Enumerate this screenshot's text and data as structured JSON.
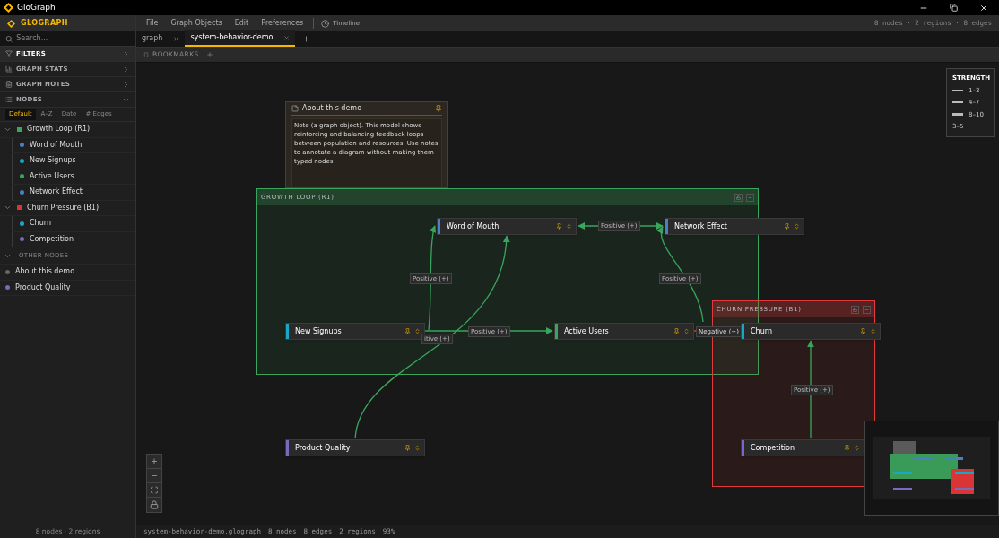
{
  "app": {
    "title": "GloGraph",
    "logo": "GLOGRAPH"
  },
  "search": {
    "placeholder": "Search..."
  },
  "sections": [
    {
      "label": "FILTERS",
      "kind": "filters",
      "expanded": false
    },
    {
      "label": "GRAPH STATS",
      "kind": "stats",
      "expanded": false
    },
    {
      "label": "GRAPH NOTES",
      "kind": "notes",
      "expanded": false
    },
    {
      "label": "NODES",
      "kind": "nodes",
      "expanded": true
    }
  ],
  "sort_tabs": [
    {
      "label": "Default",
      "selected": true
    },
    {
      "label": "A–Z",
      "selected": false
    },
    {
      "label": "Date",
      "selected": false
    },
    {
      "label": "# Edges",
      "selected": false
    }
  ],
  "node_groups": [
    {
      "label": "Growth Loop (R1)",
      "color": "#3aa55c",
      "expanded": true,
      "children": [
        {
          "label": "Word of Mouth",
          "color": "#4a7fc1"
        },
        {
          "label": "New Signups",
          "color": "#17a8c8"
        },
        {
          "label": "Active Users",
          "color": "#3aa55c"
        },
        {
          "label": "Network Effect",
          "color": "#4a7fc1"
        }
      ]
    },
    {
      "label": "Churn Pressure (B1)",
      "color": "#d93535",
      "expanded": true,
      "children": [
        {
          "label": "Churn",
          "color": "#17a8c8"
        },
        {
          "label": "Competition",
          "color": "#7b68c0"
        }
      ]
    }
  ],
  "other_nodes": {
    "label": "OTHER NODES",
    "expanded": true,
    "items": [
      {
        "label": "About this demo",
        "color": "#666666"
      },
      {
        "label": "Product Quality",
        "color": "#7b68c0"
      }
    ]
  },
  "sidebar_footer": "8 nodes · 2 regions",
  "menu": [
    "File",
    "Graph Objects",
    "Edit",
    "Preferences"
  ],
  "timeline": "Timeline",
  "summary": "8 nodes · 2 regions · 8 edges",
  "tabs": [
    {
      "label": "graph",
      "selected": false
    },
    {
      "label": "system-behavior-demo",
      "selected": true
    }
  ],
  "bookmarks": "BOOKMARKS",
  "legend": {
    "title": "STRENGTH",
    "items": [
      "1–3",
      "4–7",
      "8–10"
    ],
    "note": "3–5"
  },
  "note": {
    "title": "About this demo",
    "body": "Note (a graph object). This model shows reinforcing and balancing feedback loops between population and resources. Use notes to annotate a diagram without making them typed nodes."
  },
  "regions": [
    {
      "title": "GROWTH LOOP (R1)",
      "color": "#3aa55c"
    },
    {
      "title": "CHURN PRESSURE (B1)",
      "color": "#e03a3a"
    }
  ],
  "nodes": [
    {
      "label": "Word of Mouth",
      "color": "#4a7fc1"
    },
    {
      "label": "Network Effect",
      "color": "#4a7fc1"
    },
    {
      "label": "New Signups",
      "color": "#17a8c8"
    },
    {
      "label": "Active Users",
      "color": "#3aa55c"
    },
    {
      "label": "Churn",
      "color": "#17a8c8"
    },
    {
      "label": "Product Quality",
      "color": "#7b68c0"
    },
    {
      "label": "Competition",
      "color": "#7b68c0"
    }
  ],
  "edges": [
    {
      "label": "Positive (+)",
      "kind": "positive"
    },
    {
      "label": "Positive (+)",
      "kind": "positive"
    },
    {
      "label": "Positive (+)",
      "kind": "positive"
    },
    {
      "label": "itive (+)",
      "kind": "positive"
    },
    {
      "label": "Positive (+)",
      "kind": "positive"
    },
    {
      "label": "Negative (−)",
      "kind": "negative"
    },
    {
      "label": "Positive (+)",
      "kind": "positive"
    }
  ],
  "status": {
    "file": "system-behavior-demo.glograph",
    "nodes": "8 nodes",
    "edges": "8 edges",
    "regions": "2 regions",
    "zoom": "93%"
  }
}
